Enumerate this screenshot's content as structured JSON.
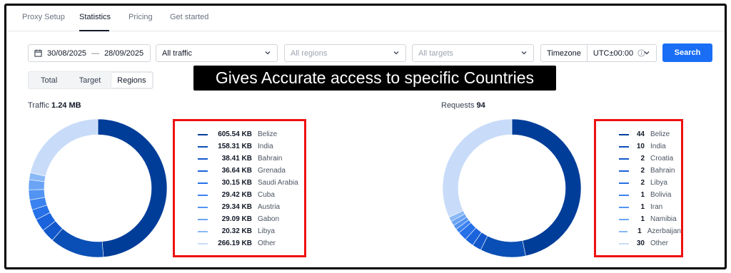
{
  "tabs": [
    "Proxy Setup",
    "Statistics",
    "Pricing",
    "Get started"
  ],
  "filters": {
    "date_from": "30/08/2025",
    "date_to": "28/09/2025",
    "dash": "—",
    "traffic": "All traffic",
    "regions": "All regions",
    "targets": "All targets",
    "timezone_label": "Timezone",
    "timezone_value": "UTC±00:00",
    "search": "Search"
  },
  "segmented": [
    "Total",
    "Target",
    "Regions"
  ],
  "banner": "Gives Accurate access to specific Countries",
  "traffic": {
    "label": "Traffic",
    "total": "1.24 MB",
    "items": [
      {
        "value": "605.54 KB",
        "label": "Belize",
        "num": 605.54,
        "color": "#003d99"
      },
      {
        "value": "158.31 KB",
        "label": "India",
        "num": 158.31,
        "color": "#0a4fb5"
      },
      {
        "value": "38.41 KB",
        "label": "Bahrain",
        "num": 38.41,
        "color": "#1258cc"
      },
      {
        "value": "36.64 KB",
        "label": "Grenada",
        "num": 36.64,
        "color": "#1a63dc"
      },
      {
        "value": "30.15 KB",
        "label": "Saudi Arabia",
        "num": 30.15,
        "color": "#2670e8"
      },
      {
        "value": "29.42 KB",
        "label": "Cuba",
        "num": 29.42,
        "color": "#3a82f0"
      },
      {
        "value": "29.34 KB",
        "label": "Austria",
        "num": 29.34,
        "color": "#5394f2"
      },
      {
        "value": "29.09 KB",
        "label": "Gabon",
        "num": 29.09,
        "color": "#6ba4f4"
      },
      {
        "value": "20.32 KB",
        "label": "Libya",
        "num": 20.32,
        "color": "#89b8f6"
      },
      {
        "value": "266.19 KB",
        "label": "Other",
        "num": 266.19,
        "color": "#c8dcf9"
      }
    ]
  },
  "requests": {
    "label": "Requests",
    "total": "94",
    "items": [
      {
        "value": "44",
        "label": "Belize",
        "num": 44,
        "color": "#003d99"
      },
      {
        "value": "10",
        "label": "India",
        "num": 10,
        "color": "#0a4fb5"
      },
      {
        "value": "2",
        "label": "Croatia",
        "num": 2,
        "color": "#1258cc"
      },
      {
        "value": "2",
        "label": "Bahrain",
        "num": 2,
        "color": "#1a63dc"
      },
      {
        "value": "2",
        "label": "Libya",
        "num": 2,
        "color": "#2670e8"
      },
      {
        "value": "1",
        "label": "Bolivia",
        "num": 1,
        "color": "#3a82f0"
      },
      {
        "value": "1",
        "label": "Iran",
        "num": 1,
        "color": "#5394f2"
      },
      {
        "value": "1",
        "label": "Namibia",
        "num": 1,
        "color": "#6ba4f4"
      },
      {
        "value": "1",
        "label": "Azerbaijan",
        "num": 1,
        "color": "#89b8f6"
      },
      {
        "value": "30",
        "label": "Other",
        "num": 30,
        "color": "#c8dcf9"
      }
    ]
  }
}
